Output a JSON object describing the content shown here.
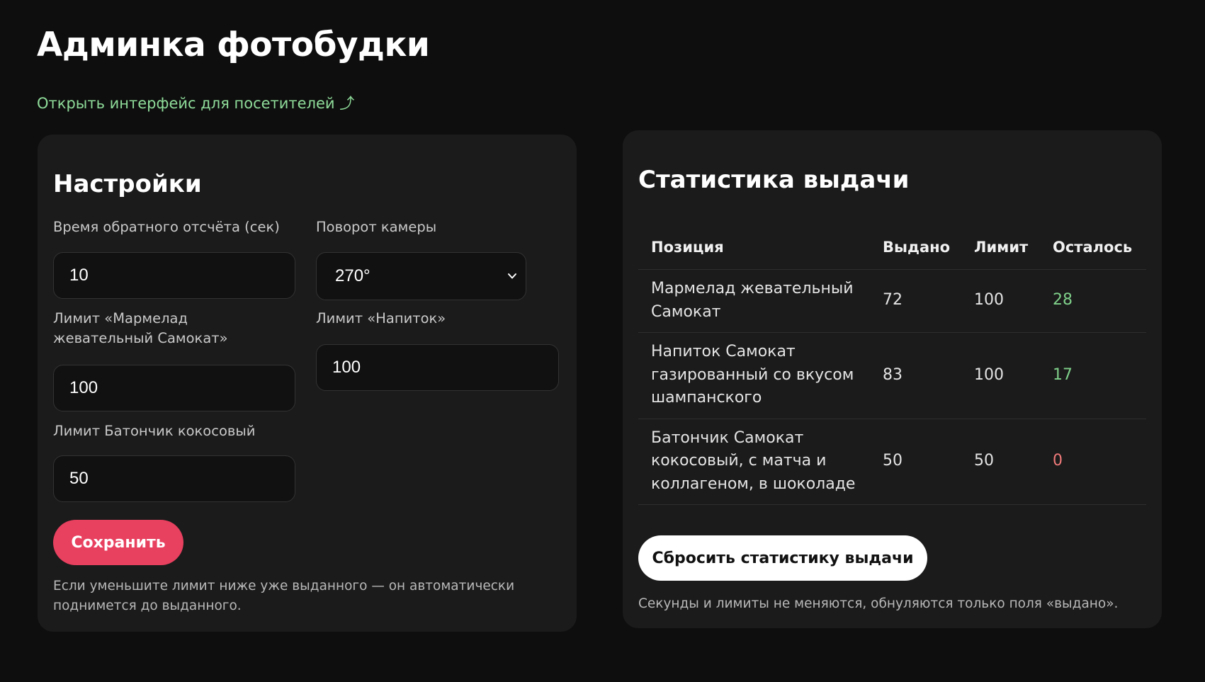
{
  "header": {
    "title": "Админка фотобудки",
    "visitor_link": "Открыть интерфейс для посетителей ⤴"
  },
  "settings": {
    "title": "Настройки",
    "countdown": {
      "label": "Время обратного отсчёта (сек)",
      "value": "10"
    },
    "rotation": {
      "label": "Поворот камеры",
      "value": "270°"
    },
    "limit_marmalade": {
      "label": "Лимит «Мармелад жевательный Самокат»",
      "value": "100"
    },
    "limit_drink": {
      "label": "Лимит «Напиток»",
      "value": "100"
    },
    "limit_bar": {
      "label": "Лимит Батончик кокосовый",
      "value": "50"
    },
    "save_label": "Сохранить",
    "note": "Если уменьшите лимит ниже уже выданного — он автоматически поднимется до выданного."
  },
  "stats": {
    "title": "Статистика выдачи",
    "columns": [
      "Позиция",
      "Выдано",
      "Лимит",
      "Осталось"
    ],
    "rows": [
      {
        "item": "Мармелад жевательный Самокат",
        "issued": "72",
        "limit": "100",
        "remaining": "28"
      },
      {
        "item": "Напиток Самокат газированный со вкусом шампанского",
        "issued": "83",
        "limit": "100",
        "remaining": "17"
      },
      {
        "item": "Батончик Самокат кокосовый, с матча и коллагеном, в шоколаде",
        "issued": "50",
        "limit": "50",
        "remaining": "0"
      }
    ],
    "reset_label": "Сбросить статистику выдачи",
    "note": "Секунды и лимиты не меняются, обнуляются только поля «выдано»."
  },
  "colors": {
    "background": "#0e0e0e",
    "card": "#1b1b1b",
    "accent": "#e8405f",
    "link": "#8fdc9a",
    "remaining_positive": "#7fd08a",
    "remaining_zero": "#f07a7a"
  }
}
